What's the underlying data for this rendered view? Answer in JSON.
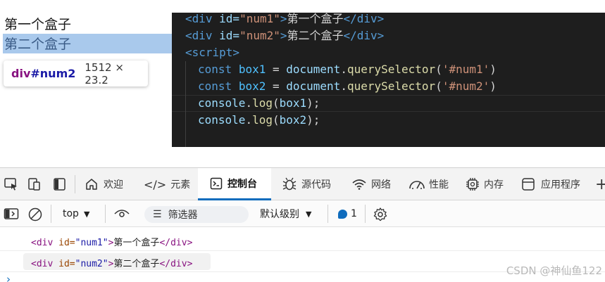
{
  "preview": {
    "div1_text": "第一个盒子",
    "div2_text": "第二个盒子",
    "tooltip": {
      "tag": "div",
      "id": "#num2",
      "size": "1512 × 23.2"
    }
  },
  "code": {
    "l1": {
      "open": "<div",
      "attr": " id=",
      "val": "\"num1\"",
      "gt": ">",
      "text": "第一个盒子",
      "close": "</div>"
    },
    "l2": {
      "open": "<div",
      "attr": " id=",
      "val": "\"num2\"",
      "gt": ">",
      "text": "第二个盒子",
      "close": "</div>"
    },
    "l3": "<script>",
    "l4": {
      "kw": "const",
      "var": "box1",
      "eq": " = ",
      "obj": "document",
      "dot": ".",
      "fn": "querySelector",
      "arg": "'#num1'",
      "end": ")"
    },
    "l5": {
      "kw": "const",
      "var": "box2",
      "eq": " = ",
      "obj": "document",
      "dot": ".",
      "fn": "querySelector",
      "arg": "'#num2'",
      "end": ")"
    },
    "l6": {
      "obj": "console",
      "dot": ".",
      "fn": "log",
      "arg": "box1",
      "end": ");"
    },
    "l7": {
      "obj": "console",
      "dot": ".",
      "fn": "log",
      "arg": "box2",
      "end": ");"
    }
  },
  "tabs": [
    {
      "label": "欢迎",
      "icon": "home-icon"
    },
    {
      "label": "元素",
      "icon": "code-icon"
    },
    {
      "label": "控制台",
      "icon": "console-icon"
    },
    {
      "label": "源代码",
      "icon": "bug-icon"
    },
    {
      "label": "网络",
      "icon": "wifi-icon"
    },
    {
      "label": "性能",
      "icon": "gauge-icon"
    },
    {
      "label": "内存",
      "icon": "chip-icon"
    },
    {
      "label": "应用程序",
      "icon": "app-icon"
    }
  ],
  "toolbar": {
    "context": "top",
    "filter_placeholder": "筛选器",
    "level": "默认级别",
    "message_count": "1"
  },
  "console": {
    "row1": {
      "open": "<div",
      "attr": " id=",
      "val": "\"num1\"",
      "gt": ">",
      "text": "第一个盒子",
      "close": "</div>"
    },
    "row2": {
      "open": "<div",
      "attr": " id=",
      "val": "\"num2\"",
      "gt": ">",
      "text": "第二个盒子",
      "close": "</div>"
    }
  },
  "watermark": "CSDN @神仙鱼122",
  "colors": {
    "accent": "#0f6cbd",
    "highlight": "#a9c9ec",
    "editor_bg": "#1e1e1e"
  }
}
